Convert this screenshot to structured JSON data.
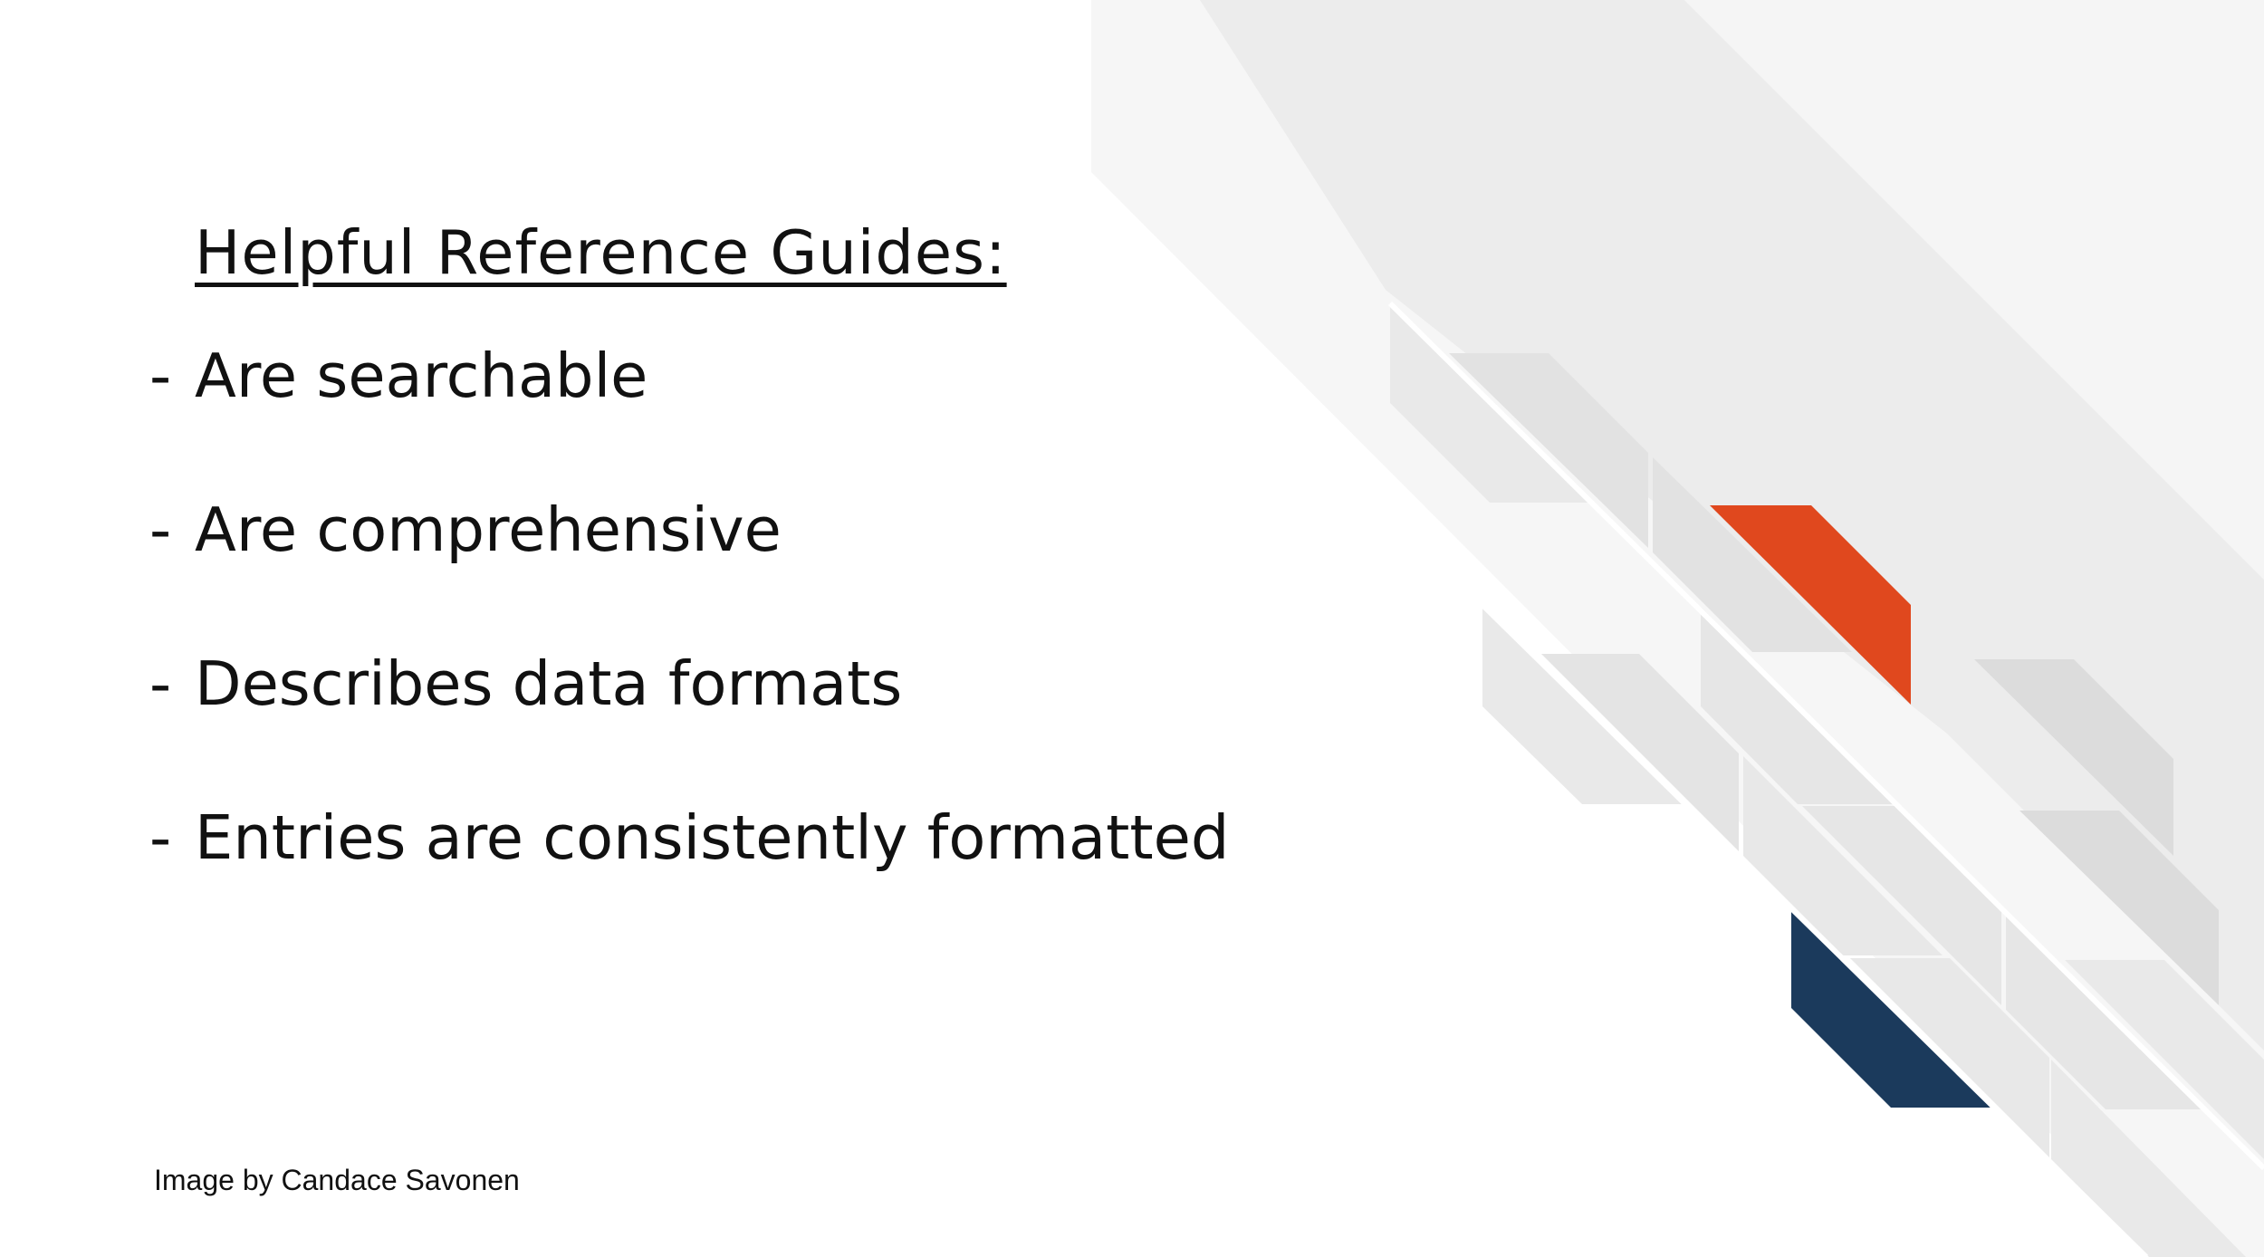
{
  "slide": {
    "heading": "Helpful Reference Guides:",
    "bullets": [
      {
        "marker": "-",
        "text": "Are searchable"
      },
      {
        "marker": "-",
        "text": "Are comprehensive"
      },
      {
        "marker": "-",
        "text": "Describes data formats"
      },
      {
        "marker": "-",
        "text": "Entries are consistently formatted"
      }
    ],
    "caption": "Image by Candace Savonen"
  },
  "colors": {
    "background": "#ffffff",
    "text": "#111111",
    "accent_orange": "#e0481e",
    "accent_navy": "#1b3a5c",
    "decor_gray_light": "#f4f4f4",
    "decor_gray_mid": "#e8e8e8",
    "decor_gray_dark": "#dcdcdc"
  }
}
